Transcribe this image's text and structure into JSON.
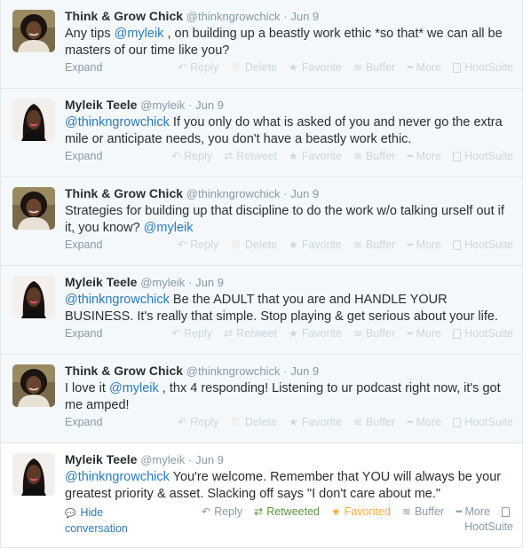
{
  "tweets": [
    {
      "fullname": "Think & Grow Chick",
      "username": "@thinkngrowchick",
      "sep": "·",
      "time": "Jun 9",
      "parts": [
        {
          "t": "Any tips "
        },
        {
          "t": "@myleik",
          "m": true
        },
        {
          "t": " , on building up a beastly work ethic *so that* we can all be masters of our time like you?"
        }
      ],
      "expand": "Expand",
      "avatar": "tgc",
      "actions": [
        {
          "key": "reply",
          "label": "Reply",
          "icon": "reply-icon",
          "glyph": "↶"
        },
        {
          "key": "delete",
          "label": "Delete",
          "icon": "trash-icon",
          "glyph": "🗑"
        },
        {
          "key": "favorite",
          "label": "Favorite",
          "icon": "star-icon",
          "glyph": "★"
        },
        {
          "key": "buffer",
          "label": "Buffer",
          "icon": "buffer-icon",
          "glyph": "≋"
        },
        {
          "key": "more",
          "label": "More",
          "icon": "more-icon",
          "glyph": "•••"
        },
        {
          "key": "hootsuite",
          "label": "HootSuite",
          "icon": "hootsuite-icon",
          "glyph": ""
        }
      ]
    },
    {
      "fullname": "Myleik Teele",
      "username": "@myleik",
      "sep": "·",
      "time": "Jun 9",
      "parts": [
        {
          "t": "@thinkngrowchick",
          "m": true
        },
        {
          "t": " If you only do what is asked of you and never go the extra mile or anticipate needs, you don't have a beastly work ethic."
        }
      ],
      "expand": "Expand",
      "avatar": "mt",
      "actions": [
        {
          "key": "reply",
          "label": "Reply",
          "icon": "reply-icon",
          "glyph": "↶"
        },
        {
          "key": "retweet",
          "label": "Retweet",
          "icon": "retweet-icon",
          "glyph": "⇄"
        },
        {
          "key": "favorite",
          "label": "Favorite",
          "icon": "star-icon",
          "glyph": "★"
        },
        {
          "key": "buffer",
          "label": "Buffer",
          "icon": "buffer-icon",
          "glyph": "≋"
        },
        {
          "key": "more",
          "label": "More",
          "icon": "more-icon",
          "glyph": "•••"
        },
        {
          "key": "hootsuite",
          "label": "HootSuite",
          "icon": "hootsuite-icon",
          "glyph": ""
        }
      ]
    },
    {
      "fullname": "Think & Grow Chick",
      "username": "@thinkngrowchick",
      "sep": "·",
      "time": "Jun 9",
      "parts": [
        {
          "t": "Strategies for building up that discipline to do the work w/o talking urself out if it, you know? "
        },
        {
          "t": "@myleik",
          "m": true
        }
      ],
      "expand": "Expand",
      "avatar": "tgc",
      "actions": [
        {
          "key": "reply",
          "label": "Reply",
          "icon": "reply-icon",
          "glyph": "↶"
        },
        {
          "key": "delete",
          "label": "Delete",
          "icon": "trash-icon",
          "glyph": "🗑"
        },
        {
          "key": "favorite",
          "label": "Favorite",
          "icon": "star-icon",
          "glyph": "★"
        },
        {
          "key": "buffer",
          "label": "Buffer",
          "icon": "buffer-icon",
          "glyph": "≋"
        },
        {
          "key": "more",
          "label": "More",
          "icon": "more-icon",
          "glyph": "•••"
        },
        {
          "key": "hootsuite",
          "label": "HootSuite",
          "icon": "hootsuite-icon",
          "glyph": ""
        }
      ]
    },
    {
      "fullname": "Myleik Teele",
      "username": "@myleik",
      "sep": "·",
      "time": "Jun 9",
      "parts": [
        {
          "t": "@thinkngrowchick",
          "m": true
        },
        {
          "t": " Be the ADULT that you are and HANDLE YOUR BUSINESS. It's really that simple. Stop playing & get serious about your life."
        }
      ],
      "expand": "Expand",
      "avatar": "mt",
      "actions": [
        {
          "key": "reply",
          "label": "Reply",
          "icon": "reply-icon",
          "glyph": "↶"
        },
        {
          "key": "retweet",
          "label": "Retweet",
          "icon": "retweet-icon",
          "glyph": "⇄"
        },
        {
          "key": "favorite",
          "label": "Favorite",
          "icon": "star-icon",
          "glyph": "★"
        },
        {
          "key": "buffer",
          "label": "Buffer",
          "icon": "buffer-icon",
          "glyph": "≋"
        },
        {
          "key": "more",
          "label": "More",
          "icon": "more-icon",
          "glyph": "•••"
        },
        {
          "key": "hootsuite",
          "label": "HootSuite",
          "icon": "hootsuite-icon",
          "glyph": ""
        }
      ]
    },
    {
      "fullname": "Think & Grow Chick",
      "username": "@thinkngrowchick",
      "sep": "·",
      "time": "Jun 9",
      "parts": [
        {
          "t": "I love it "
        },
        {
          "t": "@myleik",
          "m": true
        },
        {
          "t": " , thx 4 responding! Listening to ur podcast right now, it's got me amped!"
        }
      ],
      "expand": "Expand",
      "avatar": "tgc",
      "actions": [
        {
          "key": "reply",
          "label": "Reply",
          "icon": "reply-icon",
          "glyph": "↶"
        },
        {
          "key": "delete",
          "label": "Delete",
          "icon": "trash-icon",
          "glyph": "🗑"
        },
        {
          "key": "favorite",
          "label": "Favorite",
          "icon": "star-icon",
          "glyph": "★"
        },
        {
          "key": "buffer",
          "label": "Buffer",
          "icon": "buffer-icon",
          "glyph": "≋"
        },
        {
          "key": "more",
          "label": "More",
          "icon": "more-icon",
          "glyph": "•••"
        },
        {
          "key": "hootsuite",
          "label": "HootSuite",
          "icon": "hootsuite-icon",
          "glyph": ""
        }
      ]
    },
    {
      "fullname": "Myleik Teele",
      "username": "@myleik",
      "sep": "·",
      "time": "Jun 9",
      "parts": [
        {
          "t": "@thinkngrowchick",
          "m": true
        },
        {
          "t": " You're welcome. Remember that YOU will always be your greatest priority & asset. Slacking off says \"I don't care about me.\""
        }
      ],
      "expanded": true,
      "hide_line1": "Hide",
      "hide_line2": "conversation",
      "avatar": "mt",
      "actions": [
        {
          "key": "reply",
          "label": "Reply",
          "icon": "reply-icon",
          "glyph": "↶"
        },
        {
          "key": "retweeted",
          "label": "Retweeted",
          "icon": "retweet-icon",
          "glyph": "⇄"
        },
        {
          "key": "favorited",
          "label": "Favorited",
          "icon": "star-icon",
          "glyph": "★"
        },
        {
          "key": "buffer",
          "label": "Buffer",
          "icon": "buffer-icon",
          "glyph": "≋"
        },
        {
          "key": "more",
          "label": "More",
          "icon": "more-icon",
          "glyph": "•••"
        },
        {
          "key": "hootsuite",
          "label": "",
          "icon": "hootsuite-icon",
          "glyph": ""
        }
      ],
      "hootsuite_second_line": "HootSuite"
    }
  ],
  "colors": {
    "link": "#2b7bb9",
    "muted": "#8899a6",
    "faint": "#ccd6dd",
    "retweeted": "#5c913b",
    "favorited": "#ffac33",
    "collapsed_bg": "#f5f8fa",
    "expanded_bg": "#ffffff"
  }
}
